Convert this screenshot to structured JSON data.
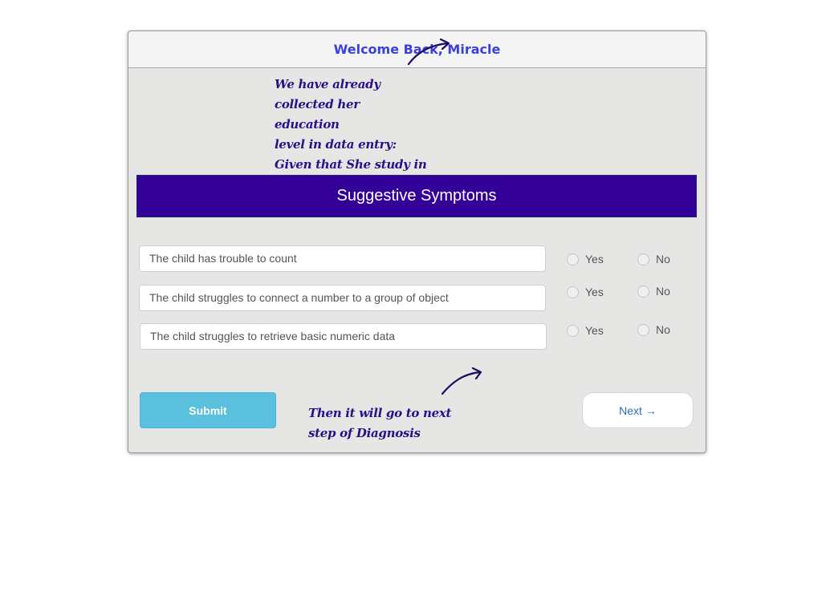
{
  "header": {
    "welcome_text": "Welcome Back, Miracle"
  },
  "annotations": {
    "top_note": "We have already\ncollected her education\nlevel in data entry:\nGiven that She study in\nPre-school",
    "bottom_note": "Then it will go to next\nstep of Diagnosis"
  },
  "banner": {
    "title": "Suggestive Symptoms"
  },
  "symptoms": [
    {
      "text": "The child has trouble to count",
      "yes_label": "Yes",
      "no_label": "No"
    },
    {
      "text": "The child struggles to connect a number to a group of object",
      "yes_label": "Yes",
      "no_label": "No"
    },
    {
      "text": "The child struggles to retrieve basic numeric data",
      "yes_label": "Yes",
      "no_label": "No"
    }
  ],
  "actions": {
    "submit_label": "Submit",
    "next_label": "Next →"
  },
  "colors": {
    "banner": "#33009a",
    "welcome": "#3b3fe0",
    "annotation": "#2a0f8a",
    "submit": "#5bc0de",
    "next_text": "#2a6fb6",
    "card_bg": "#e6e6e5"
  },
  "icons": {
    "annotation_arrow": "curved-arrow-icon"
  }
}
